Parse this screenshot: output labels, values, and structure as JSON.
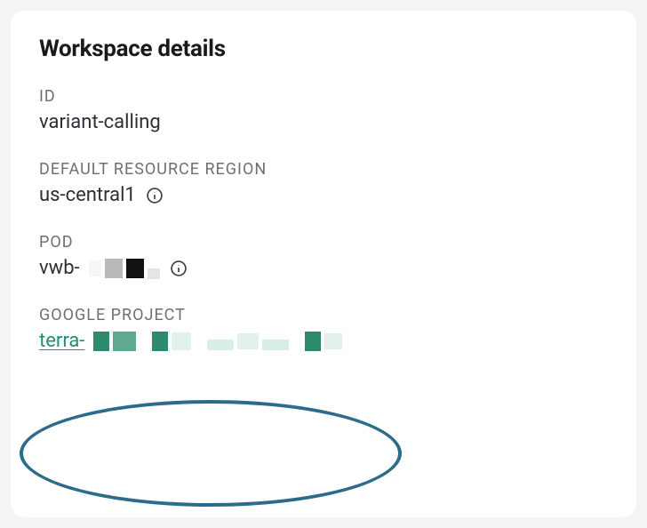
{
  "card": {
    "title": "Workspace details",
    "fields": {
      "id": {
        "label": "ID",
        "value": "variant-calling"
      },
      "region": {
        "label": "DEFAULT RESOURCE REGION",
        "value": "us-central1"
      },
      "pod": {
        "label": "POD",
        "value_prefix": "vwb-"
      },
      "google_project": {
        "label": "GOOGLE PROJECT",
        "value_prefix": "terra-"
      }
    }
  },
  "colors": {
    "link": "#1f8f75",
    "annotation": "#2c6b8a",
    "redact_dark": "#2e8a6f",
    "redact_mid": "#7fbfae",
    "redact_light": "#d9eee8"
  }
}
